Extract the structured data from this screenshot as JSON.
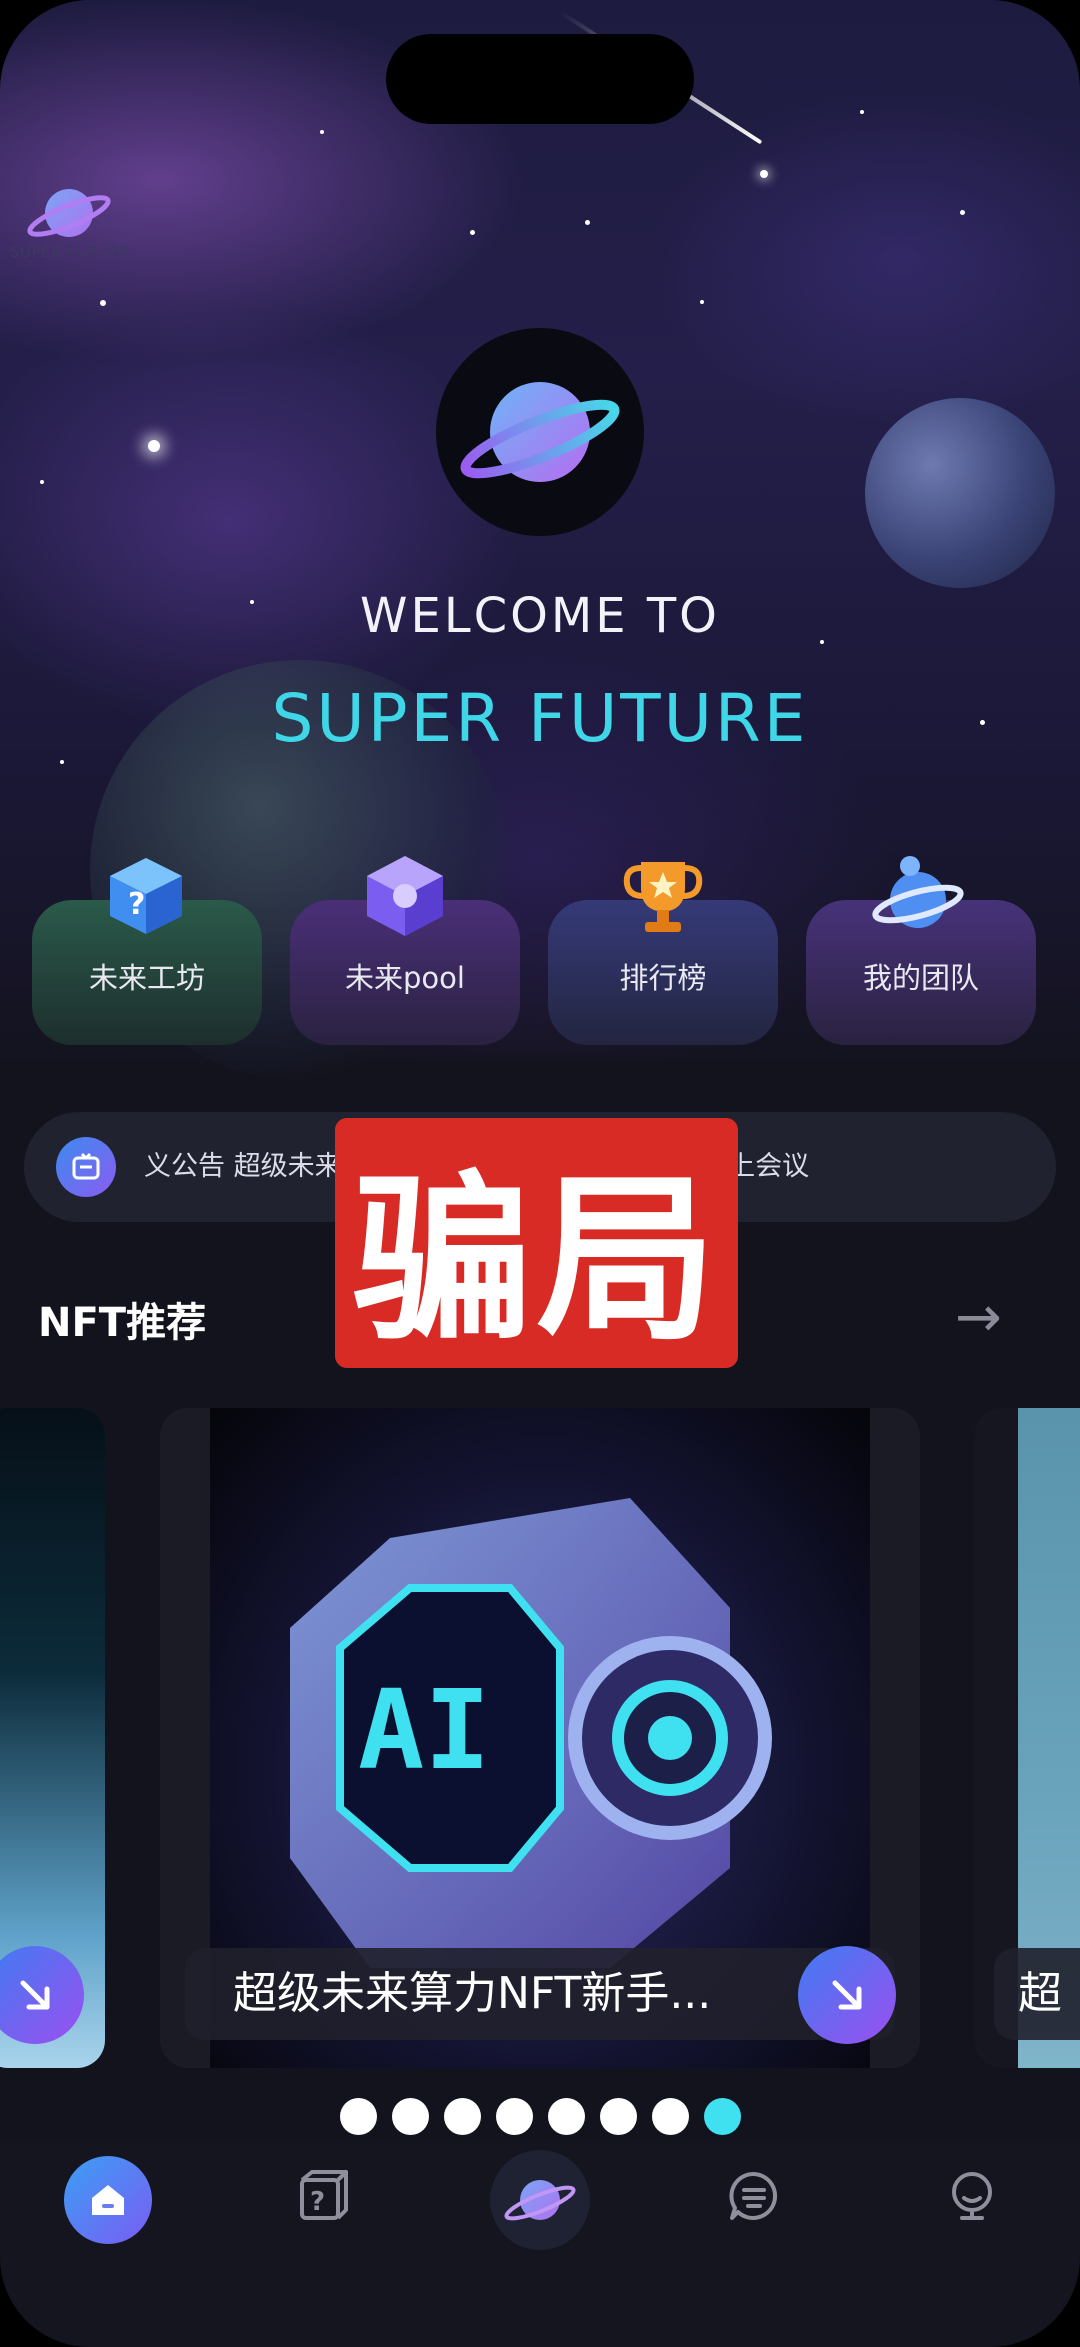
{
  "app": {
    "top_logo_text": "SUPER FUTURE",
    "welcome": "WELCOME TO",
    "brand": "SUPER FUTURE"
  },
  "menu": [
    {
      "label": "未来工坊",
      "icon": "question-cube-icon",
      "color": "#1f4a3c"
    },
    {
      "label": "未来pool",
      "icon": "crystal-cube-icon",
      "color": "#3a2a5e"
    },
    {
      "label": "排行榜",
      "icon": "trophy-icon",
      "color": "#2d2c5a"
    },
    {
      "label": "我的团队",
      "icon": "team-planet-icon",
      "color": "#37285a"
    }
  ],
  "notice": {
    "icon": "announcement-icon",
    "text": "义公告     超级未来科技第二期公告     超级未来科技线上会议"
  },
  "overlay": {
    "text": "骗局",
    "color": "#d92b25"
  },
  "section": {
    "title": "NFT推荐",
    "arrow": "→"
  },
  "nft": {
    "caption": "超级未来算力NFT新手...",
    "next_caption": "超",
    "image_label": "AI"
  },
  "carousel": {
    "total": 8,
    "active_index": 7
  },
  "tabs": [
    {
      "name": "home",
      "icon": "home-icon",
      "active": true
    },
    {
      "name": "tasks",
      "icon": "question-box-icon",
      "active": false
    },
    {
      "name": "center",
      "icon": "planet-logo-icon",
      "active": false
    },
    {
      "name": "messages",
      "icon": "chat-bubble-icon",
      "active": false
    },
    {
      "name": "profile",
      "icon": "profile-icon",
      "active": false
    }
  ],
  "colors": {
    "accent_cyan": "#3fd7e8",
    "accent_purple": "#9b4ff0",
    "accent_blue": "#3f7cf2"
  }
}
